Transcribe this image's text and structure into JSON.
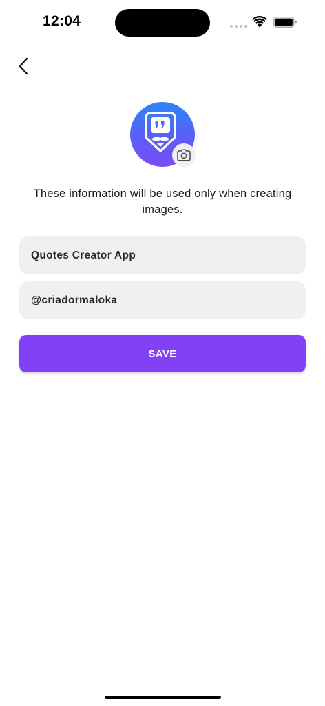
{
  "status_bar": {
    "time": "12:04"
  },
  "header": {
    "back_icon": "chevron-left-icon"
  },
  "profile": {
    "avatar_icon": "quotes-logo-icon",
    "camera_icon": "camera-icon"
  },
  "info_text": "These information will be used only when creating images.",
  "form": {
    "name_value": "Quotes Creator App",
    "handle_value": "@criadormaloka",
    "save_label": "SAVE"
  },
  "colors": {
    "accent": "#8241f5",
    "avatar_gradient_top": "#2a86f7",
    "avatar_gradient_bottom": "#7a4cf5",
    "field_background": "#f0f0f0"
  }
}
